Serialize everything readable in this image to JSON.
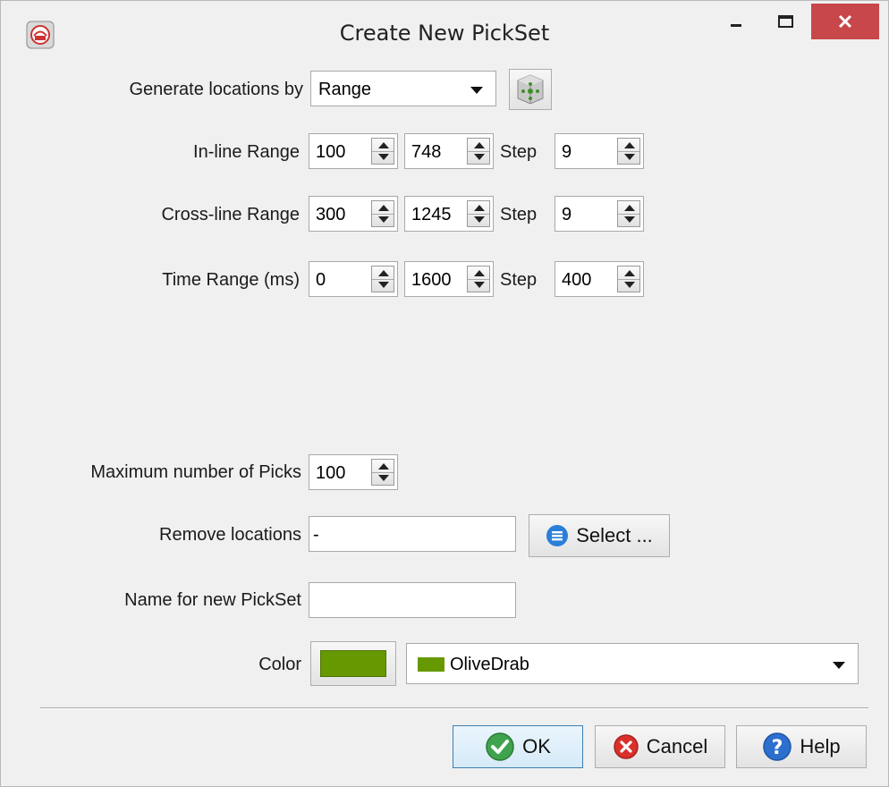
{
  "window": {
    "title": "Create New PickSet",
    "controls": {
      "minimize": "–",
      "maximize": "□",
      "close": "✕"
    }
  },
  "generate": {
    "label": "Generate locations by",
    "selected": "Range"
  },
  "inline": {
    "label": "In-line Range",
    "start": "100",
    "stop": "748",
    "step_label": "Step",
    "step": "9"
  },
  "crossline": {
    "label": "Cross-line Range",
    "start": "300",
    "stop": "1245",
    "step_label": "Step",
    "step": "9"
  },
  "time": {
    "label": "Time Range (ms)",
    "start": "0",
    "stop": "1600",
    "step_label": "Step",
    "step": "400"
  },
  "max_picks": {
    "label": "Maximum number of Picks",
    "value": "100"
  },
  "remove": {
    "label": "Remove locations",
    "value": "-",
    "button_label": "Select ..."
  },
  "name": {
    "label": "Name for new PickSet",
    "value": ""
  },
  "color": {
    "label": "Color",
    "swatch": "#669900",
    "selected": "OliveDrab"
  },
  "buttons": {
    "ok": "OK",
    "cancel": "Cancel",
    "help": "Help"
  },
  "colors": {
    "close_button": "#c7474a",
    "ok_icon": "#3fa34d",
    "cancel_icon": "#d9302c",
    "help_icon": "#2c6fcf",
    "select_icon": "#2a7fd8"
  }
}
